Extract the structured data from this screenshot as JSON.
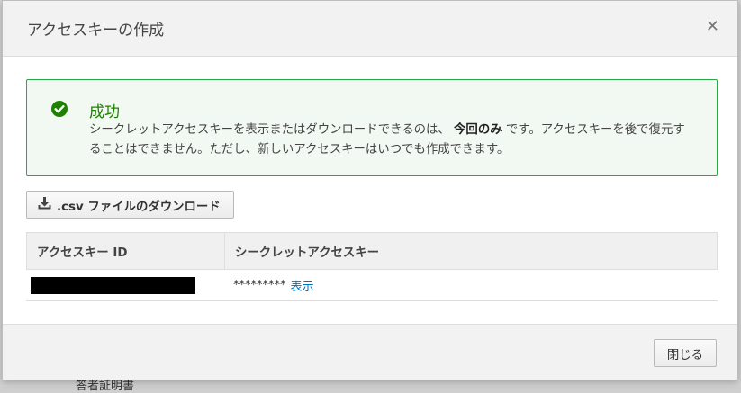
{
  "backdrop": {
    "fragment_text": "答者証明書"
  },
  "modal": {
    "title": "アクセスキーの作成",
    "close_icon": "close-icon"
  },
  "alert": {
    "icon": "check-circle-icon",
    "title": "成功",
    "message_before": "シークレットアクセスキーを表示またはダウンロードできるのは、",
    "message_bold": "今回のみ",
    "message_after": "です。アクセスキーを後で復元することはできません。ただし、新しいアクセスキーはいつでも作成できます。",
    "color": "#1d8102"
  },
  "download_button": {
    "icon": "download-icon",
    "label": ".csv ファイルのダウンロード"
  },
  "table": {
    "columns": [
      "アクセスキー ID",
      "シークレットアクセスキー"
    ],
    "rows": [
      {
        "access_key_id": "",
        "secret_mask": "*********",
        "show_link": "表示"
      }
    ]
  },
  "footer": {
    "close_label": "閉じる"
  }
}
